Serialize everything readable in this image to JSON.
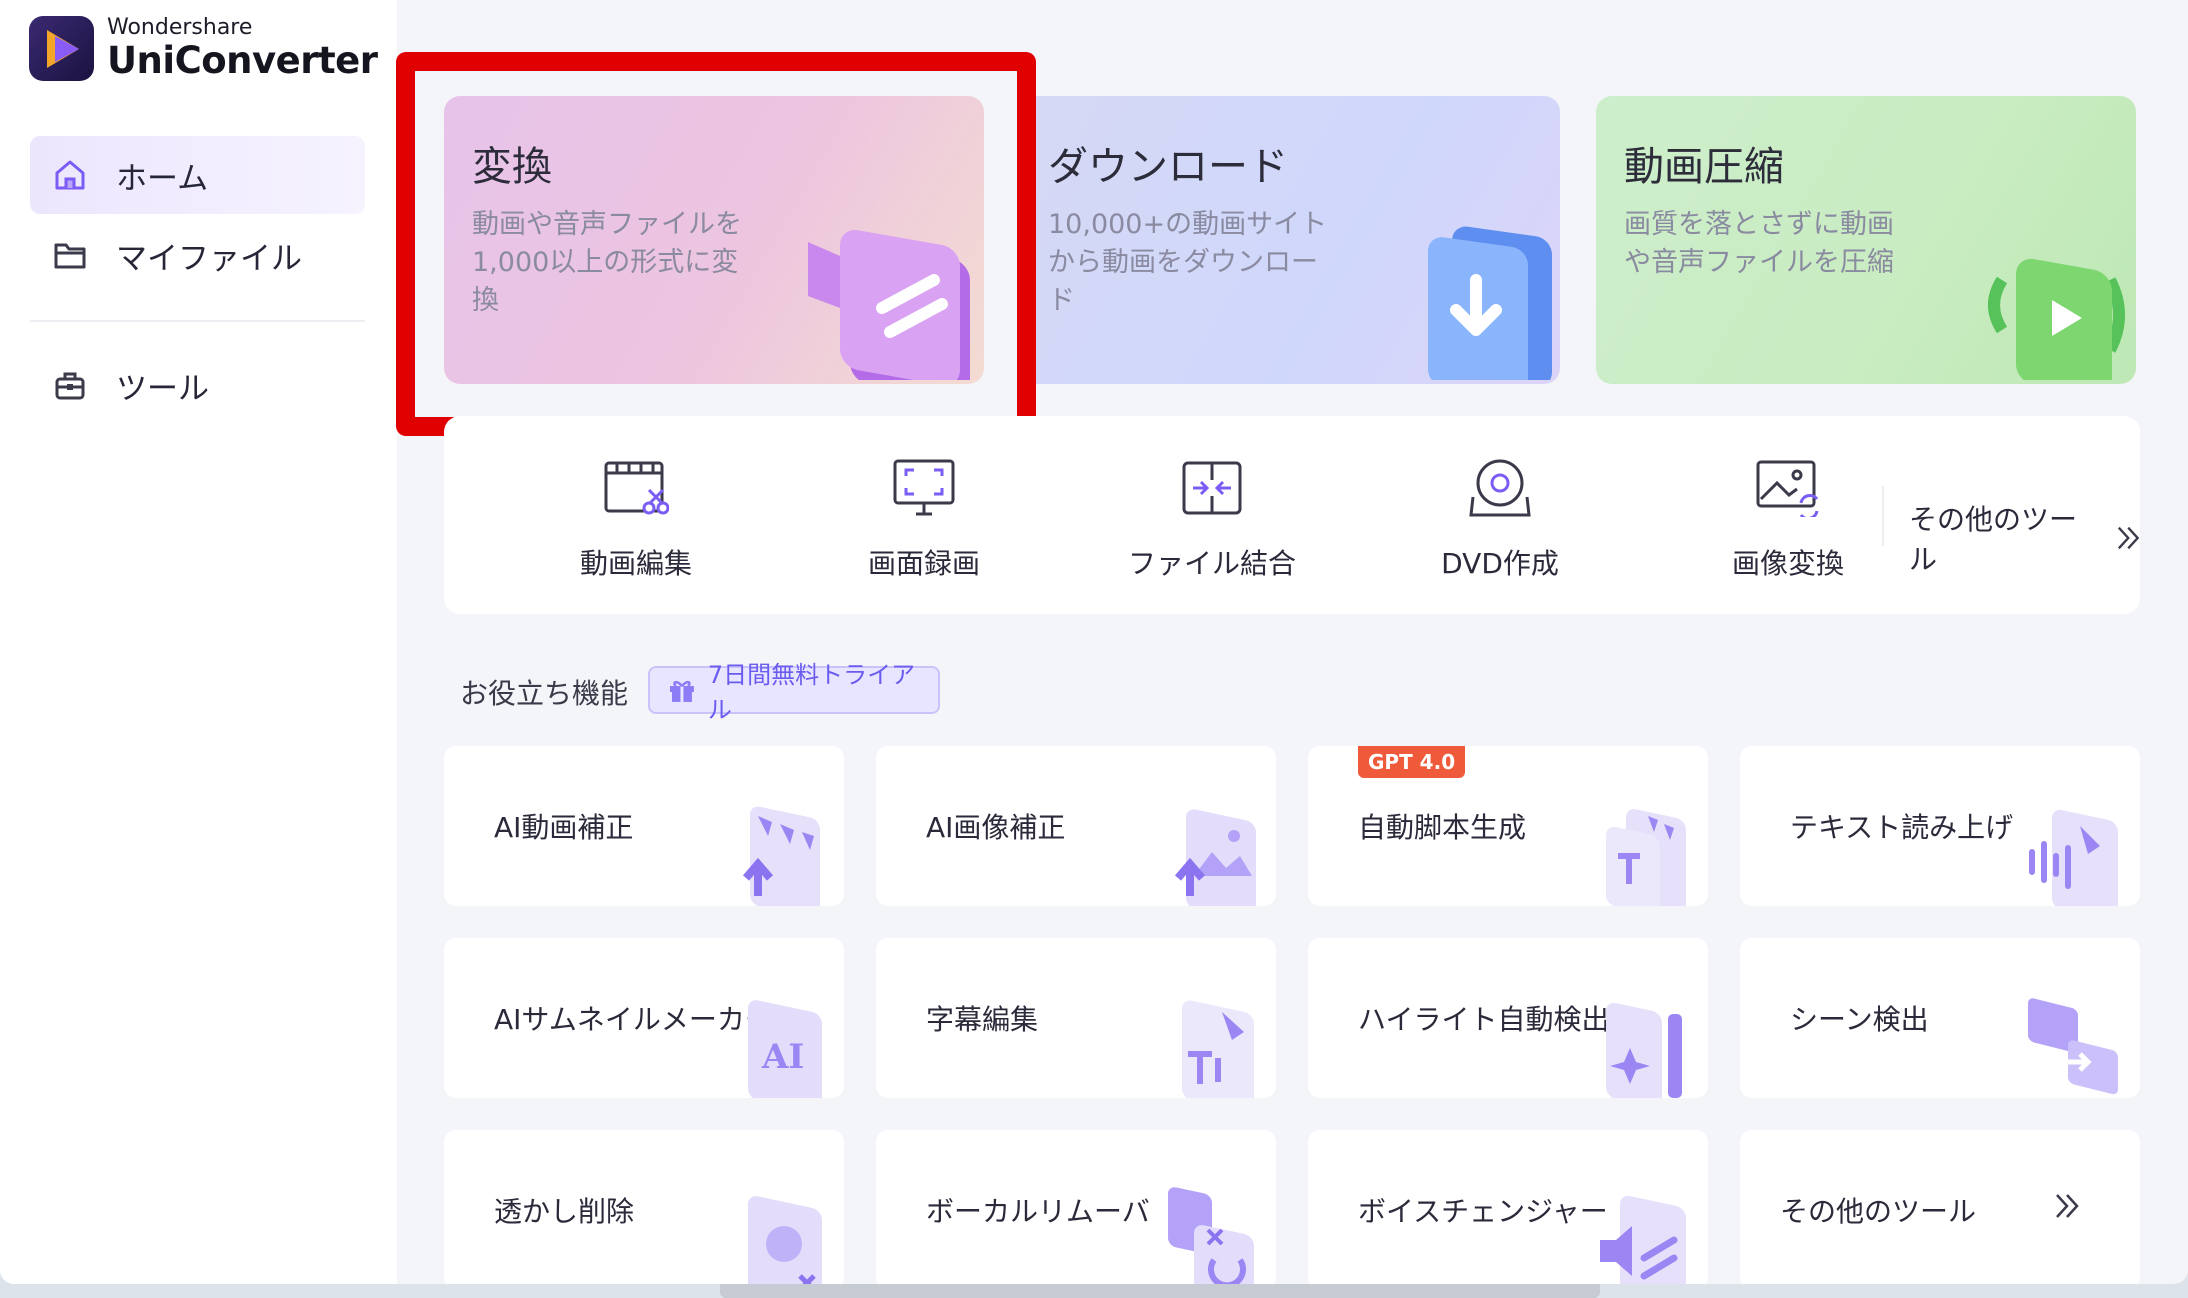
{
  "app": {
    "brand": "Wondershare",
    "product": "UniConverter"
  },
  "sidebar": {
    "items": [
      {
        "label": "ホーム",
        "icon": "home-icon",
        "active": true
      },
      {
        "label": "マイファイル",
        "icon": "folder-icon",
        "active": false
      },
      {
        "label": "ツール",
        "icon": "toolbox-icon",
        "active": false
      }
    ]
  },
  "hero": {
    "convert": {
      "title": "変換",
      "desc": "動画や音声ファイルを1,000以上の形式に変換"
    },
    "download": {
      "title": "ダウンロード",
      "desc": "10,000+の動画サイトから動画をダウンロード"
    },
    "compress": {
      "title": "動画圧縮",
      "desc": "画質を落とさずに動画や音声ファイルを圧縮"
    }
  },
  "tools": {
    "items": [
      {
        "label": "動画編集",
        "icon": "video-edit-icon"
      },
      {
        "label": "画面録画",
        "icon": "screen-record-icon"
      },
      {
        "label": "ファイル結合",
        "icon": "file-merge-icon"
      },
      {
        "label": "DVD作成",
        "icon": "dvd-icon"
      },
      {
        "label": "画像変換",
        "icon": "image-convert-icon"
      }
    ],
    "more_label": "その他のツール"
  },
  "section": {
    "title": "お役立ち機能",
    "trial_label": "7日間無料トライアル"
  },
  "features": {
    "items": [
      {
        "label": "AI動画補正"
      },
      {
        "label": "AI画像補正"
      },
      {
        "label": "自動脚本生成",
        "badge": "GPT 4.0"
      },
      {
        "label": "テキスト読み上げ"
      },
      {
        "label": "AIサムネイルメーカー"
      },
      {
        "label": "字幕編集"
      },
      {
        "label": "ハイライト自動検出"
      },
      {
        "label": "シーン検出"
      },
      {
        "label": "透かし削除"
      },
      {
        "label": "ボーカルリムーバ"
      },
      {
        "label": "ボイスチェンジャー"
      },
      {
        "label": "その他のツール"
      }
    ]
  },
  "colors": {
    "accent": "#7b5cf5",
    "highlight": "#e00000",
    "badge": "#ef5b3a"
  }
}
